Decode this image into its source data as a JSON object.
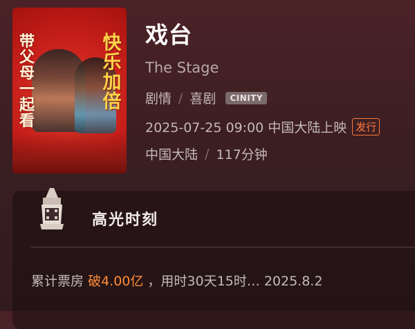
{
  "movie": {
    "title": "戏台",
    "english_title": "The Stage",
    "genres": [
      "剧情",
      "喜剧"
    ],
    "format_badge": "CINITY",
    "release": "2025-07-25 09:00 中国大陆上映",
    "release_tag": "发行",
    "region": "中国大陆",
    "duration": "117分钟"
  },
  "poster": {
    "left_slogan": "带父母一起看",
    "right_slogan": "快乐加倍"
  },
  "highlight": {
    "title": "高光时刻",
    "stat_prefix": "累计票房",
    "stat_value": "破4.00亿",
    "stat_suffix": "，用时30天15时… 2025.8.2"
  },
  "colors": {
    "accent": "#ff8c3a",
    "tag": "#ff7a3d",
    "background": "#3a1e22"
  }
}
